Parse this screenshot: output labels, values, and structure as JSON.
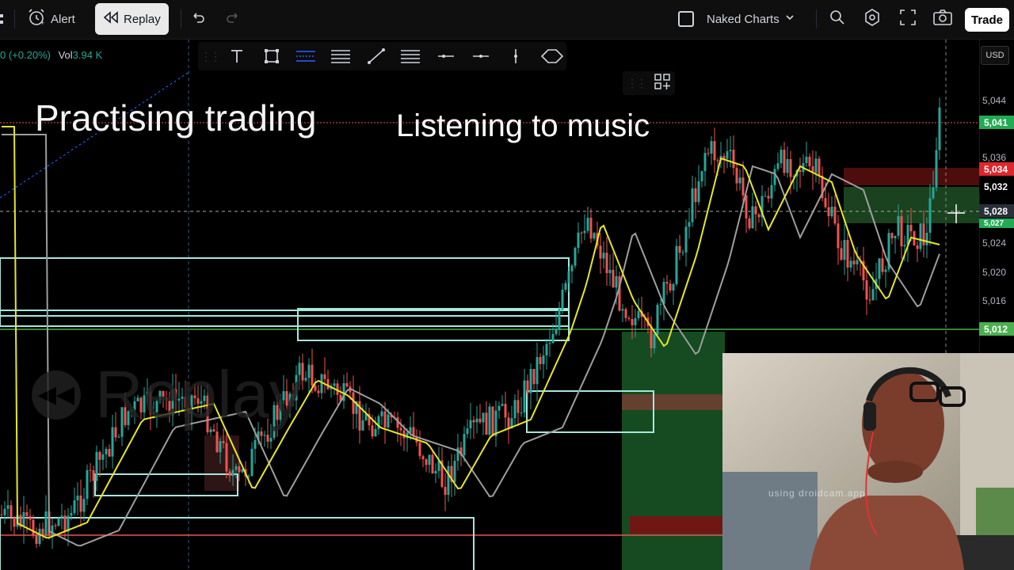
{
  "toolbar": {
    "alert_label": "Alert",
    "replay_label": "Replay",
    "layout_label": "Naked Charts",
    "trade_label": "Trade"
  },
  "symbol_info": {
    "change": "0 (+0.20%)",
    "vol_label": "Vol",
    "vol_value": "3.94 K"
  },
  "overlay": {
    "title": "Practising trading",
    "subtitle": "Listening to music"
  },
  "watermark": {
    "text": "Replay"
  },
  "price_axis": {
    "currency": "USD",
    "labels": [
      "5,044",
      "5,036",
      "5,032",
      "5,024",
      "5,020",
      "5,016"
    ],
    "tags": {
      "last": "5,041",
      "red": "5,034",
      "black": "5,032",
      "cross": "5,028",
      "green_small": "5,027",
      "green_low": "5,012"
    }
  },
  "webcam": {
    "watermark": "using droidcam.app"
  },
  "colors": {
    "up": "#26a69a",
    "down": "#ef5350",
    "ma_fast": "#e6e62a",
    "ma_slow": "#9e9e9e",
    "box": "#a8e6de"
  }
}
